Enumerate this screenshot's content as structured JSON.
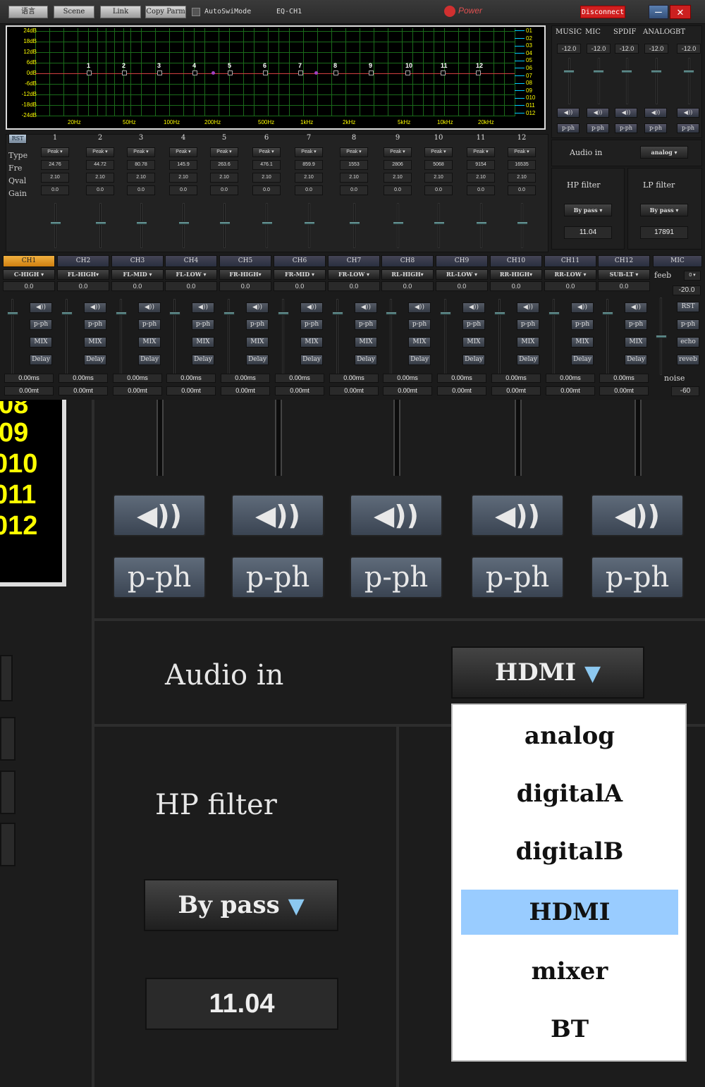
{
  "toolbar": {
    "buttons": [
      "语言",
      "Scene",
      "Link",
      "Copy Parm"
    ],
    "auto_switch_label": "AutoSwiMode",
    "eq_title": "EQ-CH1",
    "brand": "Power",
    "disconnect": "Disconnect",
    "minimize": "—",
    "close": "✕"
  },
  "eq_graph": {
    "db_labels": [
      "24dB",
      "18dB",
      "12dB",
      "6dB",
      "0dB",
      "-6dB",
      "-12dB",
      "-18dB",
      "-24dB"
    ],
    "freq_labels": [
      "20Hz",
      "50Hz",
      "100Hz",
      "200Hz",
      "500Hz",
      "1kHz",
      "2kHz",
      "5kHz",
      "10kHz",
      "20kHz"
    ],
    "band_labels": [
      "1",
      "2",
      "3",
      "4",
      "5",
      "6",
      "7",
      "8",
      "9",
      "10",
      "11",
      "12"
    ],
    "legend": [
      "01",
      "02",
      "03",
      "04",
      "05",
      "06",
      "07",
      "08",
      "09",
      "010",
      "011",
      "012"
    ],
    "colors": {
      "grid": "#1a6a1a",
      "curve": "#d04040",
      "labels": "#ffff00",
      "legend_line": "#00ccff"
    }
  },
  "eq_controls": {
    "rst": "RST",
    "row_labels": [
      "Type",
      "Fre",
      "Qval",
      "Gain"
    ],
    "bands": [
      {
        "num": "1",
        "type": "Peak ▾",
        "freq": "24.76",
        "q": "2.10",
        "gain": "0.0"
      },
      {
        "num": "2",
        "type": "Peak ▾",
        "freq": "44.72",
        "q": "2.10",
        "gain": "0.0"
      },
      {
        "num": "3",
        "type": "Peak ▾",
        "freq": "80.78",
        "q": "2.10",
        "gain": "0.0"
      },
      {
        "num": "4",
        "type": "Peak ▾",
        "freq": "145.9",
        "q": "2.10",
        "gain": "0.0"
      },
      {
        "num": "5",
        "type": "Peak ▾",
        "freq": "263.6",
        "q": "2.10",
        "gain": "0.0"
      },
      {
        "num": "6",
        "type": "Peak ▾",
        "freq": "476.1",
        "q": "2.10",
        "gain": "0.0"
      },
      {
        "num": "7",
        "type": "Peak ▾",
        "freq": "859.9",
        "q": "2.10",
        "gain": "0.0"
      },
      {
        "num": "8",
        "type": "Peak ▾",
        "freq": "1553",
        "q": "2.10",
        "gain": "0.0"
      },
      {
        "num": "9",
        "type": "Peak ▾",
        "freq": "2806",
        "q": "2.10",
        "gain": "0.0"
      },
      {
        "num": "10",
        "type": "Peak ▾",
        "freq": "5068",
        "q": "2.10",
        "gain": "0.0"
      },
      {
        "num": "11",
        "type": "Peak ▾",
        "freq": "9154",
        "q": "2.10",
        "gain": "0.0"
      },
      {
        "num": "12",
        "type": "Peak ▾",
        "freq": "16535",
        "q": "2.10",
        "gain": "0.0"
      }
    ]
  },
  "sources": [
    {
      "name": "MUSIC",
      "value": "-12.0",
      "mute_icon": "speaker-icon",
      "button": "p-ph"
    },
    {
      "name": "MIC",
      "value": "-12.0",
      "mute_icon": "speaker-icon",
      "button": "p-ph"
    },
    {
      "name": "SPDIF",
      "value": "-12.0",
      "mute_icon": "speaker-icon",
      "button": "p-ph"
    },
    {
      "name": "ANALOG",
      "value": "-12.0",
      "mute_icon": "speaker-icon",
      "button": "p-ph"
    },
    {
      "name": "BT",
      "value": "-12.0",
      "mute_icon": "speaker-icon",
      "button": "p-ph"
    }
  ],
  "right_panel": {
    "audio_in_label": "Audio in",
    "audio_in_value": "analog ▾",
    "hp_filter_label": "HP filter",
    "hp_filter_type": "By pass ▾",
    "hp_filter_freq": "11.04",
    "lp_filter_label": "LP filter",
    "lp_filter_type": "By pass ▾",
    "lp_filter_freq": "17891"
  },
  "channels": [
    {
      "name": "CH1",
      "route": "C-HIGH ▾",
      "gain": "0.0",
      "pph": "p-ph",
      "mix": "MIX",
      "delay": "Delay",
      "ms": "0.00ms",
      "mt": "0.00mt"
    },
    {
      "name": "CH2",
      "route": "FL-HIGH▾",
      "gain": "0.0",
      "pph": "p-ph",
      "mix": "MIX",
      "delay": "Delay",
      "ms": "0.00ms",
      "mt": "0.00mt"
    },
    {
      "name": "CH3",
      "route": "FL-MID ▾",
      "gain": "0.0",
      "pph": "p-ph",
      "mix": "MIX",
      "delay": "Delay",
      "ms": "0.00ms",
      "mt": "0.00mt"
    },
    {
      "name": "CH4",
      "route": "FL-LOW ▾",
      "gain": "0.0",
      "pph": "p-ph",
      "mix": "MIX",
      "delay": "Delay",
      "ms": "0.00ms",
      "mt": "0.00mt"
    },
    {
      "name": "CH5",
      "route": "FR-HIGH▾",
      "gain": "0.0",
      "pph": "p-ph",
      "mix": "MIX",
      "delay": "Delay",
      "ms": "0.00ms",
      "mt": "0.00mt"
    },
    {
      "name": "CH6",
      "route": "FR-MID ▾",
      "gain": "0.0",
      "pph": "p-ph",
      "mix": "MIX",
      "delay": "Delay",
      "ms": "0.00ms",
      "mt": "0.00mt"
    },
    {
      "name": "CH7",
      "route": "FR-LOW ▾",
      "gain": "0.0",
      "pph": "p-ph",
      "mix": "MIX",
      "delay": "Delay",
      "ms": "0.00ms",
      "mt": "0.00mt"
    },
    {
      "name": "CH8",
      "route": "RL-HIGH▾",
      "gain": "0.0",
      "pph": "p-ph",
      "mix": "MIX",
      "delay": "Delay",
      "ms": "0.00ms",
      "mt": "0.00mt"
    },
    {
      "name": "CH9",
      "route": "RL-LOW ▾",
      "gain": "0.0",
      "pph": "p-ph",
      "mix": "MIX",
      "delay": "Delay",
      "ms": "0.00ms",
      "mt": "0.00mt"
    },
    {
      "name": "CH10",
      "route": "RR-HIGH▾",
      "gain": "0.0",
      "pph": "p-ph",
      "mix": "MIX",
      "delay": "Delay",
      "ms": "0.00ms",
      "mt": "0.00mt"
    },
    {
      "name": "CH11",
      "route": "RR-LOW ▾",
      "gain": "0.0",
      "pph": "p-ph",
      "mix": "MIX",
      "delay": "Delay",
      "ms": "0.00ms",
      "mt": "0.00mt"
    },
    {
      "name": "CH12",
      "route": "SUB-LT ▾",
      "gain": "0.0",
      "pph": "p-ph",
      "mix": "MIX",
      "delay": "Delay",
      "ms": "0.00ms",
      "mt": "0.00mt"
    }
  ],
  "mic_channel": {
    "name": "MIC",
    "feeb_label": "feeb",
    "feeb_value": "0 ▾",
    "gain": "-20.0",
    "rst": "RST",
    "pph": "p-ph",
    "echo": "echo",
    "reverb": "reveb",
    "noise_label": "noise",
    "noise_value": "-60"
  },
  "zoom": {
    "legend_partial": [
      "08",
      "09",
      "010",
      "011",
      "012"
    ],
    "mute_icon": "speaker-icon",
    "pph_buttons": [
      "p-ph",
      "p-ph",
      "p-ph",
      "p-ph",
      "p-ph"
    ],
    "audio_in_label": "Audio in",
    "audio_in_value": "HDMI",
    "hp_filter_label": "HP filter",
    "hp_filter_type": "By pass",
    "hp_filter_freq": "11.04",
    "dropdown_options": [
      "analog",
      "digitalA",
      "digitalB",
      "HDMI",
      "mixer",
      "BT"
    ],
    "dropdown_selected": "HDMI"
  }
}
